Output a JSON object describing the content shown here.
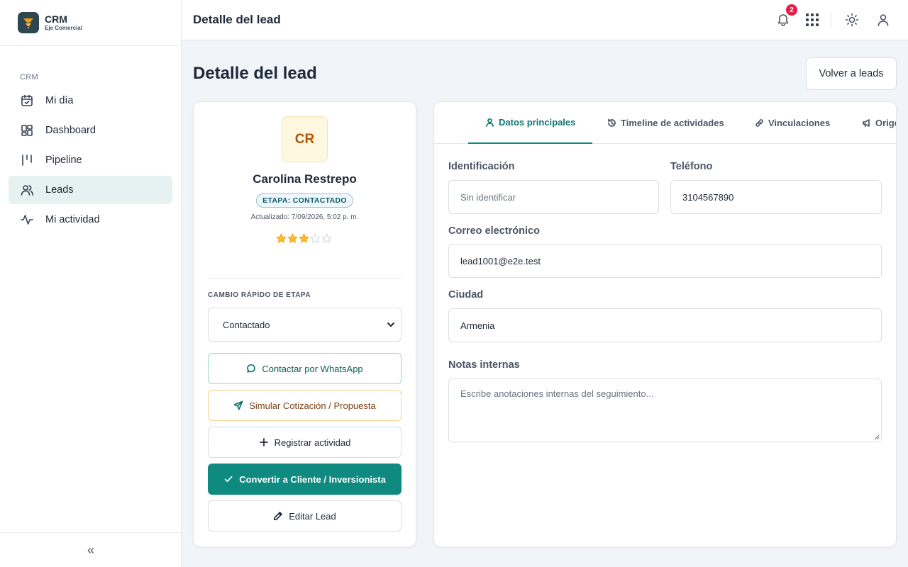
{
  "brand": {
    "title": "CRM",
    "subtitle": "Eje Comercial"
  },
  "sidebar": {
    "section": "CRM",
    "items": [
      {
        "label": "Mi día",
        "icon": "calendar-check-icon"
      },
      {
        "label": "Dashboard",
        "icon": "dashboard-grid-icon"
      },
      {
        "label": "Pipeline",
        "icon": "pipeline-icon"
      },
      {
        "label": "Leads",
        "icon": "users-icon",
        "active": true
      },
      {
        "label": "Mi actividad",
        "icon": "activity-icon"
      }
    ],
    "collapse_label": "«"
  },
  "header": {
    "title": "Detalle del lead",
    "notification_count": "2"
  },
  "page": {
    "title": "Detalle del lead",
    "back_label": "Volver a leads"
  },
  "lead": {
    "initials": "CR",
    "name": "Carolina Restrepo",
    "stage_badge": "ETAPA: CONTACTADO",
    "updated": "Actualizado: 7/09/2026, 5:02 p. m.",
    "rating": 3,
    "rating_max": 5
  },
  "quick_stage": {
    "label": "CAMBIO RÁPIDO DE ETAPA",
    "selected": "Contactado"
  },
  "actions": {
    "whatsapp": "Contactar por WhatsApp",
    "quote": "Simular Cotización / Propuesta",
    "activity": "Registrar actividad",
    "convert": "Convertir a Cliente / Inversionista",
    "edit": "Editar Lead"
  },
  "tabs": [
    {
      "label": "Datos principales",
      "active": true
    },
    {
      "label": "Timeline de actividades"
    },
    {
      "label": "Vinculaciones"
    },
    {
      "label": "Origen"
    }
  ],
  "form": {
    "identificacion": {
      "label": "Identificación",
      "placeholder": "Sin identificar"
    },
    "telefono": {
      "label": "Teléfono",
      "value": "3104567890"
    },
    "correo": {
      "label": "Correo electrónico",
      "value": "lead1001@e2e.test"
    },
    "ciudad": {
      "label": "Ciudad",
      "value": "Armenia"
    },
    "notas": {
      "label": "Notas internas",
      "placeholder": "Escribe anotaciones internas del seguimiento..."
    }
  },
  "colors": {
    "accent": "#0f8a80",
    "badge": "#e11d48",
    "star": "#fbbf24"
  }
}
